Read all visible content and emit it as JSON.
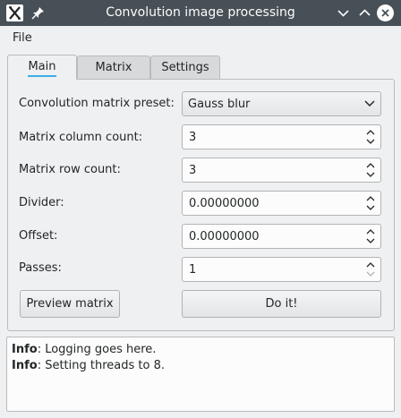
{
  "window": {
    "title": "Convolution image processing",
    "icons": [
      "app-icon",
      "pin-icon",
      "minimize-icon",
      "maximize-icon",
      "close-icon"
    ]
  },
  "menu": {
    "file": "File"
  },
  "tabs": {
    "main": "Main",
    "matrix": "Matrix",
    "settings": "Settings"
  },
  "form": {
    "preset_label": "Convolution matrix preset:",
    "preset_value": "Gauss blur",
    "columns_label": "Matrix column count:",
    "columns_value": "3",
    "rows_label": "Matrix row count:",
    "rows_value": "3",
    "divider_label": "Divider:",
    "divider_value": "0.00000000",
    "offset_label": "Offset:",
    "offset_value": "0.00000000",
    "passes_label": "Passes:",
    "passes_value": "1"
  },
  "buttons": {
    "preview": "Preview matrix",
    "doit": "Do it!"
  },
  "log": [
    {
      "level": "Info",
      "message": ": Logging goes here."
    },
    {
      "level": "Info",
      "message": ": Setting threads to 8."
    }
  ],
  "colors": {
    "titlebar": "#475057",
    "accent": "#3daee9",
    "window_bg": "#eff0f1"
  }
}
